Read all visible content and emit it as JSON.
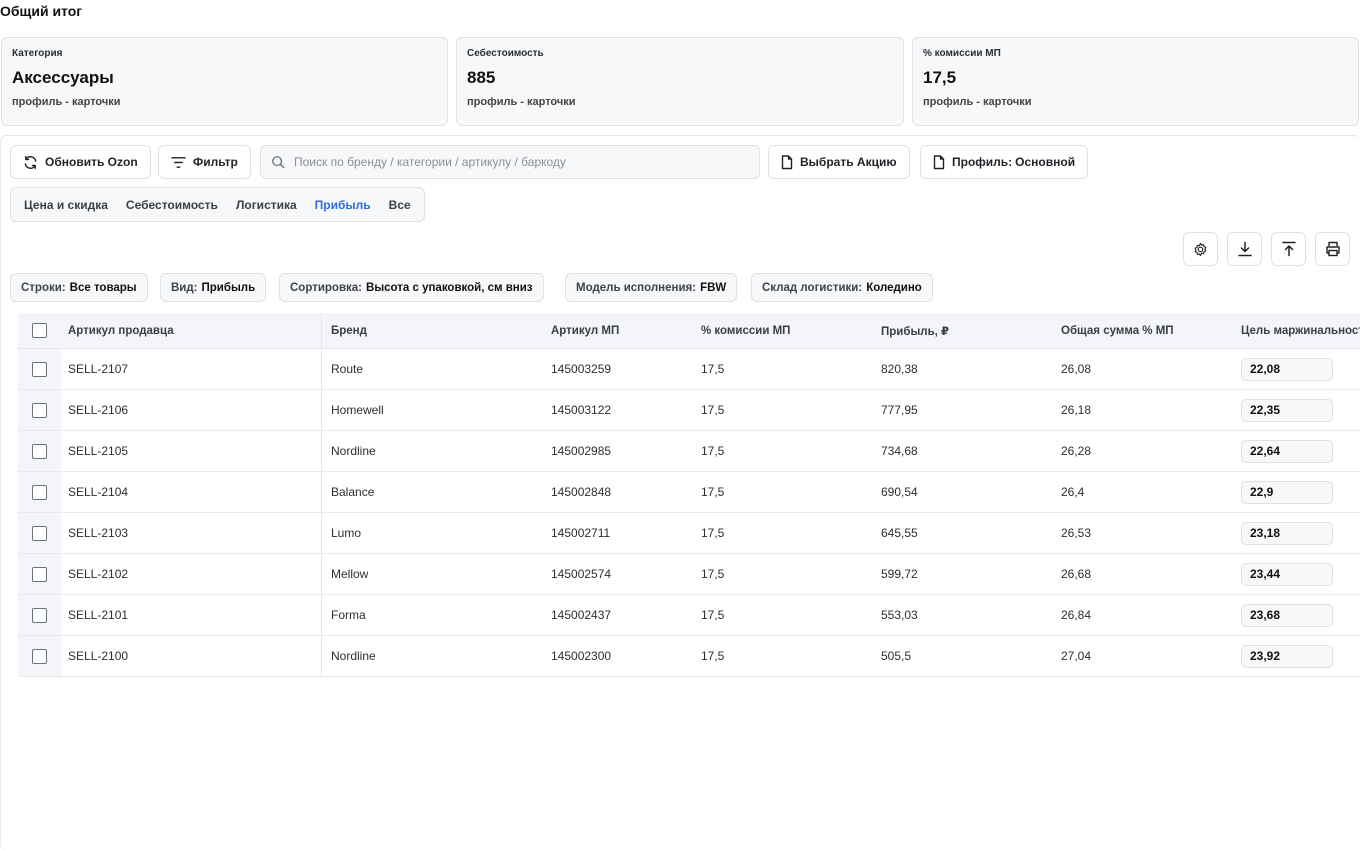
{
  "page_title": "Общий итог",
  "summary": [
    {
      "label": "Категория",
      "value": "Аксессуары",
      "sub": "профиль - карточки"
    },
    {
      "label": "Себестоимость",
      "value": "885",
      "sub": "профиль - карточки"
    },
    {
      "label": "% комиссии МП",
      "value": "17,5",
      "sub": "профиль - карточки"
    }
  ],
  "toolbar": {
    "refresh_label": "Обновить Ozon",
    "filter_label": "Фильтр",
    "search_placeholder": "Поиск по бренду / категории / артикулу / баркоду",
    "promo_label": "Выбрать Акцию",
    "profile_prefix": "Профиль:",
    "profile_value": "Основной"
  },
  "tabs": [
    {
      "label": "Цена и скидка",
      "active": false
    },
    {
      "label": "Себестоимость",
      "active": false
    },
    {
      "label": "Логистика",
      "active": false
    },
    {
      "label": "Прибыль",
      "active": true
    },
    {
      "label": "Все",
      "active": false
    }
  ],
  "active_tab_color": "#2f6fd6",
  "actions": [
    "gear-icon",
    "download-icon",
    "upload-icon",
    "printer-icon"
  ],
  "chips": [
    {
      "key": "Строки:",
      "value": "Все товары"
    },
    {
      "key": "Вид:",
      "value": "Прибыль"
    },
    {
      "key": "Сортировка:",
      "value": "Высота с упаковкой, см вниз"
    },
    {
      "key": "Модель исполнения:",
      "value": "FBW"
    },
    {
      "key": "Склад логистики:",
      "value": "Коледино"
    }
  ],
  "table": {
    "headers": {
      "seller": "Артикул продавца",
      "brand": "Бренд",
      "art": "Артикул МП",
      "comm": "% комиссии МП",
      "profit": "Прибыль, ₽",
      "total": "Общая сумма % МП",
      "target": "Цель маржинальности"
    },
    "rows": [
      {
        "seller": "SELL-2107",
        "brand": "Route",
        "art": "145003259",
        "comm": "17,5",
        "profit": "820,38",
        "total": "26,08",
        "target": "22,08"
      },
      {
        "seller": "SELL-2106",
        "brand": "Homewell",
        "art": "145003122",
        "comm": "17,5",
        "profit": "777,95",
        "total": "26,18",
        "target": "22,35"
      },
      {
        "seller": "SELL-2105",
        "brand": "Nordline",
        "art": "145002985",
        "comm": "17,5",
        "profit": "734,68",
        "total": "26,28",
        "target": "22,64"
      },
      {
        "seller": "SELL-2104",
        "brand": "Balance",
        "art": "145002848",
        "comm": "17,5",
        "profit": "690,54",
        "total": "26,4",
        "target": "22,9"
      },
      {
        "seller": "SELL-2103",
        "brand": "Lumo",
        "art": "145002711",
        "comm": "17,5",
        "profit": "645,55",
        "total": "26,53",
        "target": "23,18"
      },
      {
        "seller": "SELL-2102",
        "brand": "Mellow",
        "art": "145002574",
        "comm": "17,5",
        "profit": "599,72",
        "total": "26,68",
        "target": "23,44"
      },
      {
        "seller": "SELL-2101",
        "brand": "Forma",
        "art": "145002437",
        "comm": "17,5",
        "profit": "553,03",
        "total": "26,84",
        "target": "23,68"
      },
      {
        "seller": "SELL-2100",
        "brand": "Nordline",
        "art": "145002300",
        "comm": "17,5",
        "profit": "505,5",
        "total": "27,04",
        "target": "23,92"
      }
    ]
  }
}
